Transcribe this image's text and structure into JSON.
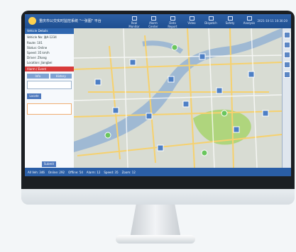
{
  "app": {
    "title": "重庆市公交实时监控系统 \"一张图\" 平台",
    "clock": "2021-10-11 10:30:20"
  },
  "nav": [
    {
      "label": "Real Monitor",
      "icon": "monitor-icon"
    },
    {
      "label": "Alarm Center",
      "icon": "alarm-icon"
    },
    {
      "label": "Data Report",
      "icon": "report-icon"
    },
    {
      "label": "Video",
      "icon": "video-icon"
    },
    {
      "label": "Dispatch",
      "icon": "dispatch-icon"
    },
    {
      "label": "Safety",
      "icon": "safety-icon"
    },
    {
      "label": "Analysis",
      "icon": "analysis-icon"
    }
  ],
  "left_panel": {
    "title": "Vehicle Details",
    "rows": [
      "Vehicle No: 渝A·1234",
      "Route: 101",
      "Status: Online",
      "Speed: 35 km/h",
      "Driver: Zhang",
      "Location: Jiangbei"
    ],
    "band": "Alarm / Event",
    "tabs": [
      "Info",
      "History"
    ],
    "action": "Locate",
    "bottom_button": "Submit"
  },
  "map": {
    "water_color": "#9fb9d3",
    "road_color": "#f6d16e",
    "green_color": "#a8d46d",
    "pin_color": "#4d7fc5"
  },
  "status_bar": {
    "items": [
      "All Veh: 346",
      "Online: 292",
      "Offline: 54",
      "Alarm: 12",
      "Speed: 35",
      "Zoom: 12"
    ]
  }
}
